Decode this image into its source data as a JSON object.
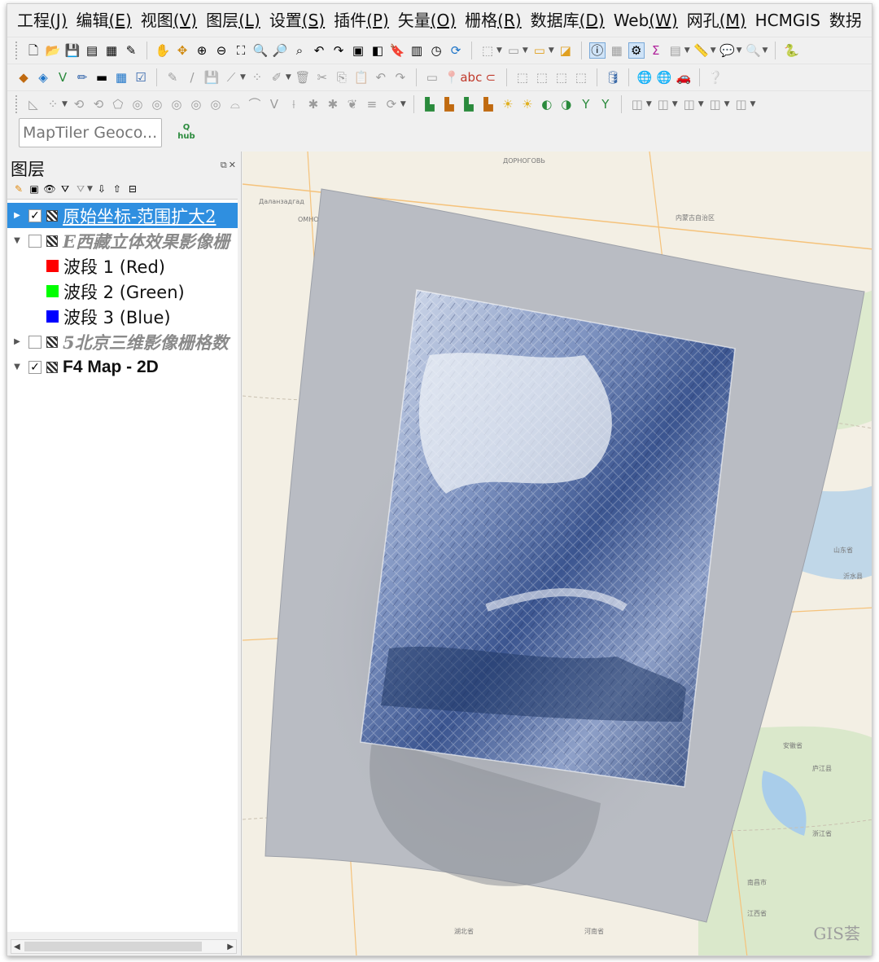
{
  "menu": [
    {
      "label": "工程",
      "key": "(J)"
    },
    {
      "label": "编辑",
      "key": "(E)"
    },
    {
      "label": "视图",
      "key": "(V)"
    },
    {
      "label": "图层",
      "key": "(L)"
    },
    {
      "label": "设置",
      "key": "(S)"
    },
    {
      "label": "插件",
      "key": "(P)"
    },
    {
      "label": "矢量",
      "key": "(O)"
    },
    {
      "label": "栅格",
      "key": "(R)"
    },
    {
      "label": "数据库",
      "key": "(D)"
    },
    {
      "label": "Web",
      "key": "(W)"
    },
    {
      "label": "网孔",
      "key": "(M)"
    },
    {
      "label": "HCMGIS",
      "key": ""
    },
    {
      "label": "数拐",
      "key": ""
    }
  ],
  "geocoder": {
    "placeholder": "MapTiler Geoco..."
  },
  "qhub": {
    "label": "hub"
  },
  "layers_panel": {
    "title": "图层"
  },
  "layers": [
    {
      "name": "原始坐标-范围扩大2",
      "checked": true,
      "selected": true
    },
    {
      "name": "E西藏立体效果影像栅",
      "checked": false,
      "selected": false
    },
    {
      "name": "波段 1 (Red)",
      "band": true,
      "color": "#ff0000"
    },
    {
      "name": "波段 2 (Green)",
      "band": true,
      "color": "#00ff00"
    },
    {
      "name": "波段 3 (Blue)",
      "band": true,
      "color": "#0000ff"
    },
    {
      "name": "5北京三维影像栅格数",
      "checked": false,
      "selected": false
    },
    {
      "name": "F4 Map - 2D",
      "checked": true,
      "selected": false
    }
  ],
  "map": {
    "labels": [
      "ДОРНОГОВЬ",
      "Даланзадгад",
      "ОМНОГ",
      "内蒙古自治区",
      "山东省",
      "安徽省",
      "湖北省",
      "河南省",
      "江西省",
      "浙江省",
      "沂水县",
      "庐江县",
      "南昌市"
    ],
    "colors": {
      "land": "#f3efe4",
      "water": "#a9cdea",
      "green": "#cfe6c0",
      "road": "#f5c27a",
      "sheet": "#b9bcc3",
      "relief": "#3b5590"
    }
  },
  "watermark": "GIS荟"
}
